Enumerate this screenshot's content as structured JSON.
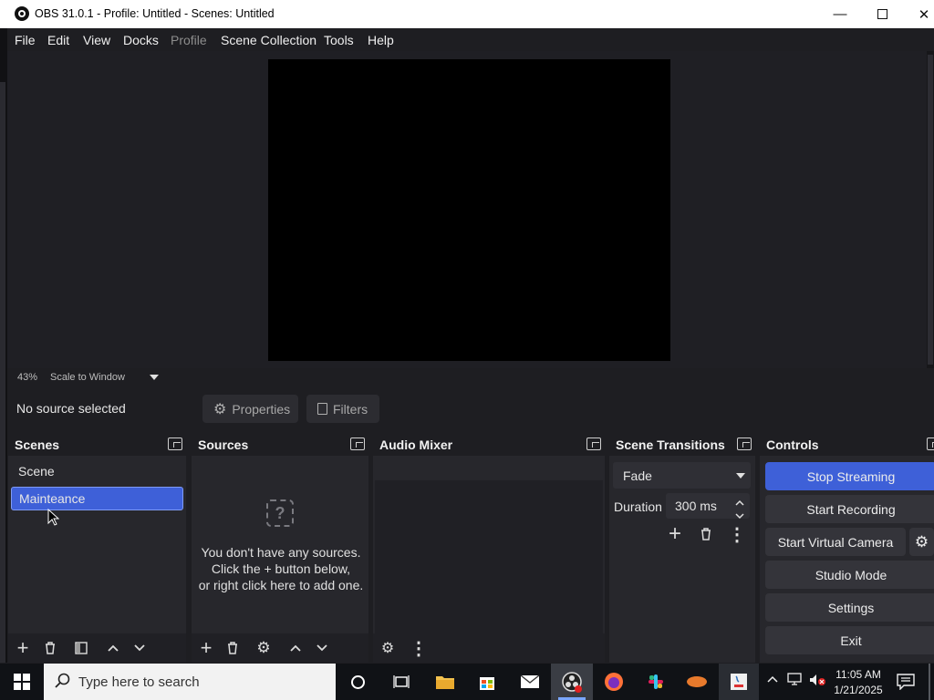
{
  "window": {
    "title": "OBS 31.0.1 - Profile: Untitled - Scenes: Untitled"
  },
  "menu": {
    "file": "File",
    "edit": "Edit",
    "view": "View",
    "docks": "Docks",
    "profile": "Profile",
    "scene_collection": "Scene Collection",
    "tools": "Tools",
    "help": "Help"
  },
  "preview": {
    "zoom": "43%",
    "scale_mode": "Scale to Window"
  },
  "context": {
    "status": "No source selected",
    "properties_label": "Properties",
    "filters_label": "Filters"
  },
  "scenes": {
    "title": "Scenes",
    "items": [
      {
        "label": "Scene",
        "selected": false
      },
      {
        "label": "Mainteance",
        "selected": true
      }
    ]
  },
  "sources": {
    "title": "Sources",
    "empty_line1": "You don't have any sources.",
    "empty_line2": "Click the + button below,",
    "empty_line3": "or right click here to add one."
  },
  "mixer": {
    "title": "Audio Mixer"
  },
  "transitions": {
    "title": "Scene Transitions",
    "selected": "Fade",
    "duration_label": "Duration",
    "duration_value": "300 ms"
  },
  "controls": {
    "title": "Controls",
    "stop_streaming": "Stop Streaming",
    "start_recording": "Start Recording",
    "start_virtual_camera": "Start Virtual Camera",
    "studio_mode": "Studio Mode",
    "settings": "Settings",
    "exit": "Exit"
  },
  "taskbar": {
    "search_placeholder": "Type here to search",
    "time": "11:05 AM",
    "date": "1/21/2025"
  },
  "colors": {
    "accent": "#3e60d8",
    "panel": "#27272c",
    "background": "#1e1e22"
  }
}
